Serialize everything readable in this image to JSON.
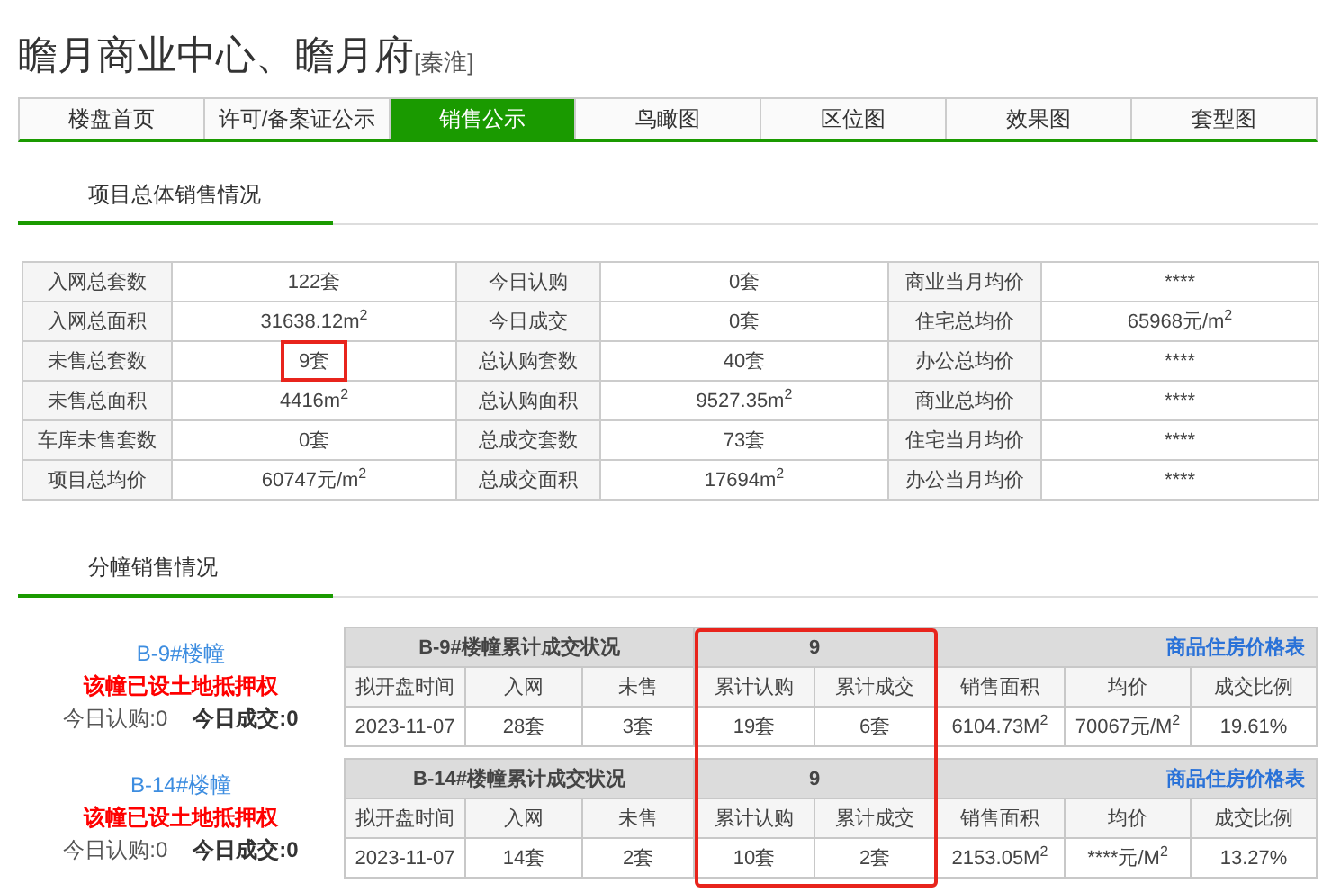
{
  "title": {
    "name": "瞻月商业中心、瞻月府",
    "district": "[秦淮]"
  },
  "tabs": [
    {
      "label": "楼盘首页",
      "selected": false
    },
    {
      "label": "许可/备案证公示",
      "selected": false
    },
    {
      "label": "销售公示",
      "selected": true
    },
    {
      "label": "鸟瞰图",
      "selected": false
    },
    {
      "label": "区位图",
      "selected": false
    },
    {
      "label": "效果图",
      "selected": false
    },
    {
      "label": "套型图",
      "selected": false
    }
  ],
  "summary": {
    "heading": "项目总体销售情况",
    "rows": [
      [
        {
          "label": "入网总套数",
          "value": "122套",
          "highlighted": false
        },
        {
          "label": "今日认购",
          "value": "0套"
        },
        {
          "label": "商业当月均价",
          "value": "****"
        }
      ],
      [
        {
          "label": "入网总面积",
          "value": "31638.12m$^{2}$",
          "highlighted": false
        },
        {
          "label": "今日成交",
          "value": "0套"
        },
        {
          "label": "住宅总均价",
          "value": "65968元/m$^{2}$"
        }
      ],
      [
        {
          "label": "未售总套数",
          "value": "9套",
          "highlighted": true
        },
        {
          "label": "总认购套数",
          "value": "40套"
        },
        {
          "label": "办公总均价",
          "value": "****"
        }
      ],
      [
        {
          "label": "未售总面积",
          "value": "4416m$^{2}$",
          "highlighted": false
        },
        {
          "label": "总认购面积",
          "value": "9527.35m$^{2}$"
        },
        {
          "label": "商业总均价",
          "value": "****"
        }
      ],
      [
        {
          "label": "车库未售套数",
          "value": "0套",
          "highlighted": false
        },
        {
          "label": "总成交套数",
          "value": "73套"
        },
        {
          "label": "住宅当月均价",
          "value": "****"
        }
      ],
      [
        {
          "label": "项目总均价",
          "value": "60747元/m$^{2}$",
          "highlighted": false
        },
        {
          "label": "总成交面积",
          "value": "17694m$^{2}$"
        },
        {
          "label": "办公当月均价",
          "value": "****"
        }
      ]
    ]
  },
  "buildings": {
    "heading": "分幢销售情况",
    "cumulative_columns_highlighted": true,
    "items": [
      {
        "name": "B-9#楼幢",
        "notice": "该幢已设土地抵押权",
        "today_subscribed": "今日认购:0",
        "today_closed": "今日成交:0",
        "table_title": "B-9#楼幢累计成交状况",
        "count": "9",
        "link": "商品住房价格表",
        "columns": [
          "拟开盘时间",
          "入网",
          "未售",
          "累计认购",
          "累计成交",
          "销售面积",
          "均价",
          "成交比例"
        ],
        "cells": [
          "2023-11-07",
          "28套",
          "3套",
          "19套",
          "6套",
          "6104.73M$^{2}$",
          "70067元/M$^{2}$",
          "19.61%"
        ]
      },
      {
        "name": "B-14#楼幢",
        "notice": "该幢已设土地抵押权",
        "today_subscribed": "今日认购:0",
        "today_closed": "今日成交:0",
        "table_title": "B-14#楼幢累计成交状况",
        "count": "9",
        "link": "商品住房价格表",
        "columns": [
          "拟开盘时间",
          "入网",
          "未售",
          "累计认购",
          "累计成交",
          "销售面积",
          "均价",
          "成交比例"
        ],
        "cells": [
          "2023-11-07",
          "14套",
          "2套",
          "10套",
          "2套",
          "2153.05M$^{2}$",
          "****元/M$^{2}$",
          "13.27%"
        ]
      }
    ]
  }
}
